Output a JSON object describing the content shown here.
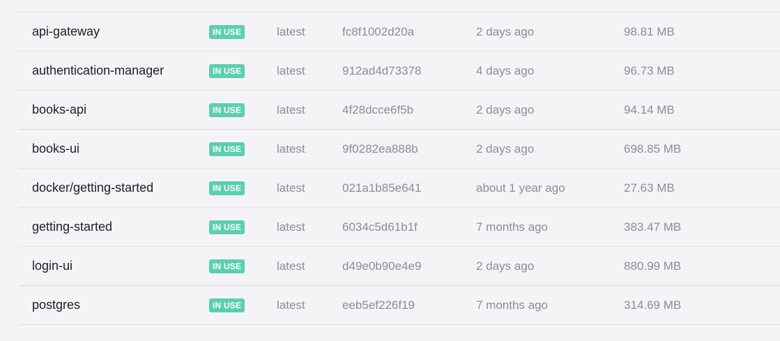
{
  "images": {
    "rows": [
      {
        "name": "api-gateway",
        "status": "IN USE",
        "tag": "latest",
        "image_id": "fc8f1002d20a",
        "created": "2 days ago",
        "size": "98.81 MB"
      },
      {
        "name": "authentication-manager",
        "status": "IN USE",
        "tag": "latest",
        "image_id": "912ad4d73378",
        "created": "4 days ago",
        "size": "96.73 MB"
      },
      {
        "name": "books-api",
        "status": "IN USE",
        "tag": "latest",
        "image_id": "4f28dcce6f5b",
        "created": "2 days ago",
        "size": "94.14 MB"
      },
      {
        "name": "books-ui",
        "status": "IN USE",
        "tag": "latest",
        "image_id": "9f0282ea888b",
        "created": "2 days ago",
        "size": "698.85 MB"
      },
      {
        "name": "docker/getting-started",
        "status": "IN USE",
        "tag": "latest",
        "image_id": "021a1b85e641",
        "created": "about 1 year ago",
        "size": "27.63 MB"
      },
      {
        "name": "getting-started",
        "status": "IN USE",
        "tag": "latest",
        "image_id": "6034c5d61b1f",
        "created": "7 months ago",
        "size": "383.47 MB"
      },
      {
        "name": "login-ui",
        "status": "IN USE",
        "tag": "latest",
        "image_id": "d49e0b90e4e9",
        "created": "2 days ago",
        "size": "880.99 MB"
      },
      {
        "name": "postgres",
        "status": "IN USE",
        "tag": "latest",
        "image_id": "eeb5ef226f19",
        "created": "7 months ago",
        "size": "314.69 MB"
      }
    ]
  },
  "colors": {
    "badge_bg": "#5ccfb0",
    "page_bg": "#f4f4f6",
    "name_text": "#1e1e24",
    "muted_text": "#8c8c94"
  }
}
